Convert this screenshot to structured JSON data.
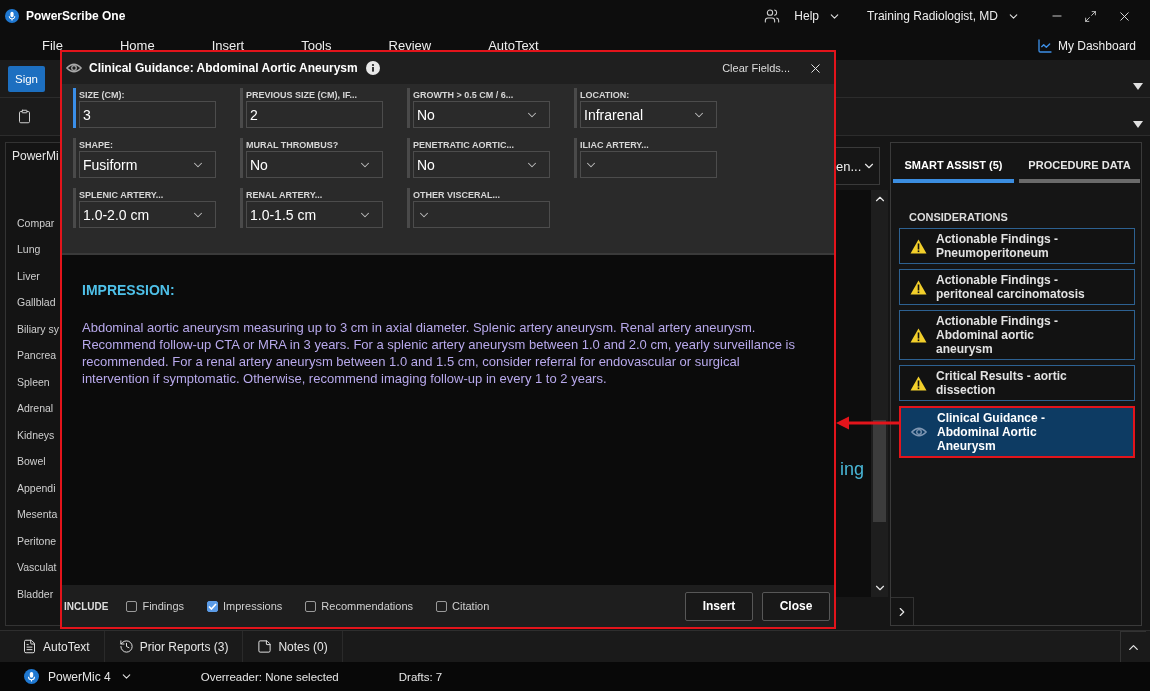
{
  "title_bar": {
    "app_title": "PowerScribe One",
    "help": "Help",
    "user": "Training Radiologist, MD"
  },
  "menu": [
    "File",
    "Home",
    "Insert",
    "Tools",
    "Review",
    "AutoText"
  ],
  "dashboard_link": "My Dashboard",
  "toolbar": {
    "sign": "Sign"
  },
  "left_panel": {
    "title": "PowerMi",
    "items": [
      "Compar",
      "Lung",
      "Liver",
      "Gallblad",
      "Biliary sy",
      "Pancrea",
      "Spleen",
      "Adrenal",
      "Kidneys",
      "Bowel",
      "Appendi",
      "Mesenta",
      "Peritone",
      "Vasculat",
      "Bladder"
    ]
  },
  "center": {
    "dropdown_value": "en...",
    "editor_text": "ing"
  },
  "right_panel": {
    "tabs": [
      {
        "label": "SMART ASSIST (5)",
        "selected": true
      },
      {
        "label": "PROCEDURE DATA",
        "selected": false
      }
    ],
    "section_title": "CONSIDERATIONS",
    "considerations": [
      {
        "kind": "warning",
        "text": "Actionable Findings - Pneumoperitoneum",
        "selected": false,
        "annotated": false
      },
      {
        "kind": "warning",
        "text": "Actionable Findings - peritoneal carcinomatosis",
        "selected": false,
        "annotated": false
      },
      {
        "kind": "warning",
        "text": "Actionable Findings - Abdominal aortic aneurysm",
        "selected": false,
        "annotated": false
      },
      {
        "kind": "warning",
        "text": "Critical Results - aortic dissection",
        "selected": false,
        "annotated": false
      },
      {
        "kind": "guidance",
        "text": "Clinical Guidance - Abdominal Aortic Aneurysm",
        "selected": true,
        "annotated": true
      }
    ]
  },
  "dialog": {
    "title": "Clinical Guidance: Abdominal Aortic Aneurysm",
    "clear": "Clear Fields...",
    "annotated": true,
    "fields": [
      {
        "label": "SIZE (CM):",
        "kind": "text",
        "value": "3",
        "focused": true
      },
      {
        "label": "PREVIOUS SIZE (CM), IF...",
        "kind": "text",
        "value": "2",
        "focused": false
      },
      {
        "label": "GROWTH > 0.5 CM / 6...",
        "kind": "select",
        "value": "No",
        "focused": false
      },
      {
        "label": "LOCATION:",
        "kind": "select",
        "value": "Infrarenal",
        "focused": false
      },
      {
        "label": "SHAPE:",
        "kind": "select",
        "value": "Fusiform",
        "focused": false
      },
      {
        "label": "MURAL THROMBUS?",
        "kind": "select",
        "value": "No",
        "focused": false
      },
      {
        "label": "PENETRATIC AORTIC...",
        "kind": "select",
        "value": "No",
        "focused": false
      },
      {
        "label": "ILIAC ARTERY...",
        "kind": "select",
        "focused": false
      },
      {
        "label": "SPLENIC ARTERY...",
        "kind": "select",
        "value": "1.0-2.0 cm",
        "focused": false
      },
      {
        "label": "RENAL ARTERY...",
        "kind": "select",
        "value": "1.0-1.5 cm",
        "focused": false
      },
      {
        "label": "OTHER VISCERAL...",
        "kind": "select",
        "focused": false
      }
    ],
    "impression_heading": "IMPRESSION:",
    "impression_text": "Abdominal aortic aneurysm measuring up to 3 cm in axial diameter. Splenic artery aneurysm. Renal artery aneurysm. Recommend follow-up CTA or MRA in 3 years. For a splenic artery aneurysm between 1.0 and 2.0 cm, yearly surveillance is recommended. For a renal artery aneurysm between 1.0 and 1.5 cm, consider referral for endovascular or surgical intervention if symptomatic. Otherwise, recommend imaging follow-up in every 1 to 2 years.",
    "include_label": "INCLUDE",
    "include": [
      {
        "label": "Findings",
        "checked": false
      },
      {
        "label": "Impressions",
        "checked": true
      },
      {
        "label": "Recommendations",
        "checked": false
      },
      {
        "label": "Citation",
        "checked": false
      }
    ],
    "buttons": [
      "Insert",
      "Close"
    ]
  },
  "bottom_tabs": [
    {
      "kind": "autotext",
      "label": "AutoText"
    },
    {
      "kind": "history",
      "label": "Prior Reports (3)"
    },
    {
      "kind": "notes",
      "label": "Notes (0)"
    }
  ],
  "status_bar": {
    "device": "PowerMic 4",
    "overreader": "Overreader: None selected",
    "drafts": "Drafts: 7"
  }
}
